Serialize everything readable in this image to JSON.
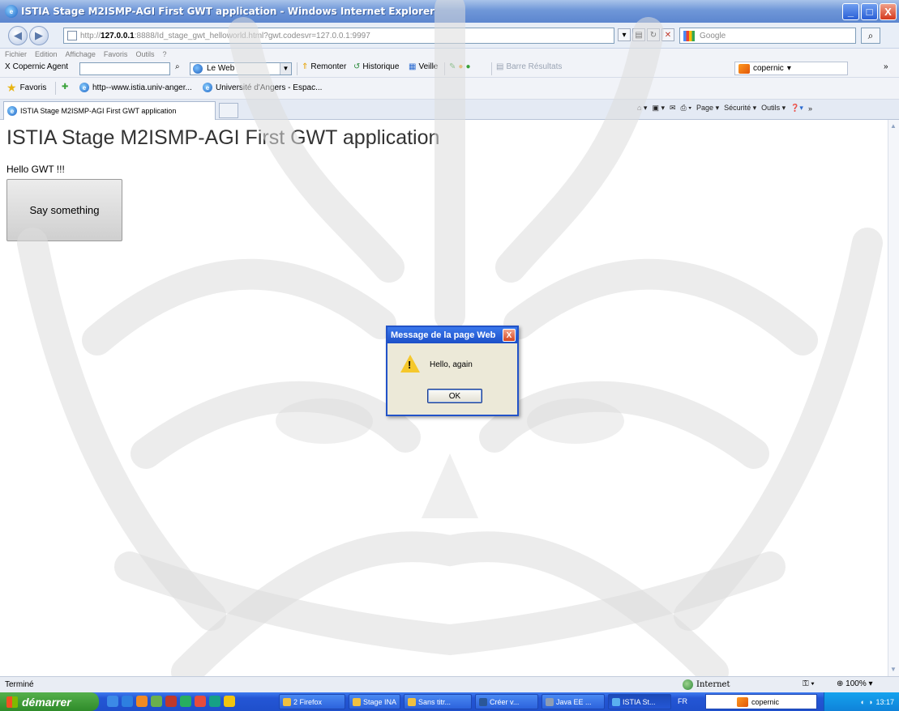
{
  "window": {
    "title": "ISTIA Stage M2ISMP-AGI First GWT application - Windows Internet Explorer",
    "minimize": "_",
    "maximize": "□",
    "close": "X"
  },
  "address": {
    "prefix": "http://",
    "host": "127.0.0.1",
    "path": ":8888/Id_stage_gwt_helloworld.html?gwt.codesvr=127.0.0.1:9997"
  },
  "search": {
    "placeholder": "Google"
  },
  "menu": {
    "items": [
      "Fichier",
      "Edition",
      "Affichage",
      "Favoris",
      "Outils",
      "?"
    ]
  },
  "copernic_bar": {
    "close": "X",
    "agent_label": "Copernic Agent",
    "web_select": "Le Web",
    "remonter": "Remonter",
    "historique": "Historique",
    "veille": "Veille",
    "barre": "Barre Résultats",
    "copernic": "copernic"
  },
  "favorites": {
    "label": "Favoris",
    "items": [
      "http--www.istia.univ-anger...",
      "Université d'Angers - Espac..."
    ]
  },
  "tab": {
    "title": "ISTIA Stage M2ISMP-AGI First GWT application"
  },
  "commands": {
    "page": "Page",
    "securite": "Sécurité",
    "outils": "Outils"
  },
  "page": {
    "heading": "ISTIA Stage M2ISMP-AGI First GWT application",
    "hello": "Hello GWT !!!",
    "button": "Say something"
  },
  "dialog": {
    "title": "Message de la page Web",
    "close": "X",
    "message": "Hello, again",
    "ok": "OK"
  },
  "status": {
    "text": "Terminé",
    "zone": "Internet",
    "zoom": "100%"
  },
  "taskbar": {
    "start": "démarrer",
    "tasks": [
      "2 Firefox",
      "Stage INA",
      "Sans titr...",
      "Créer v...",
      "Java EE ...",
      "ISTIA St..."
    ],
    "lang": "FR",
    "copernic": "copernic",
    "time": "13:17"
  }
}
